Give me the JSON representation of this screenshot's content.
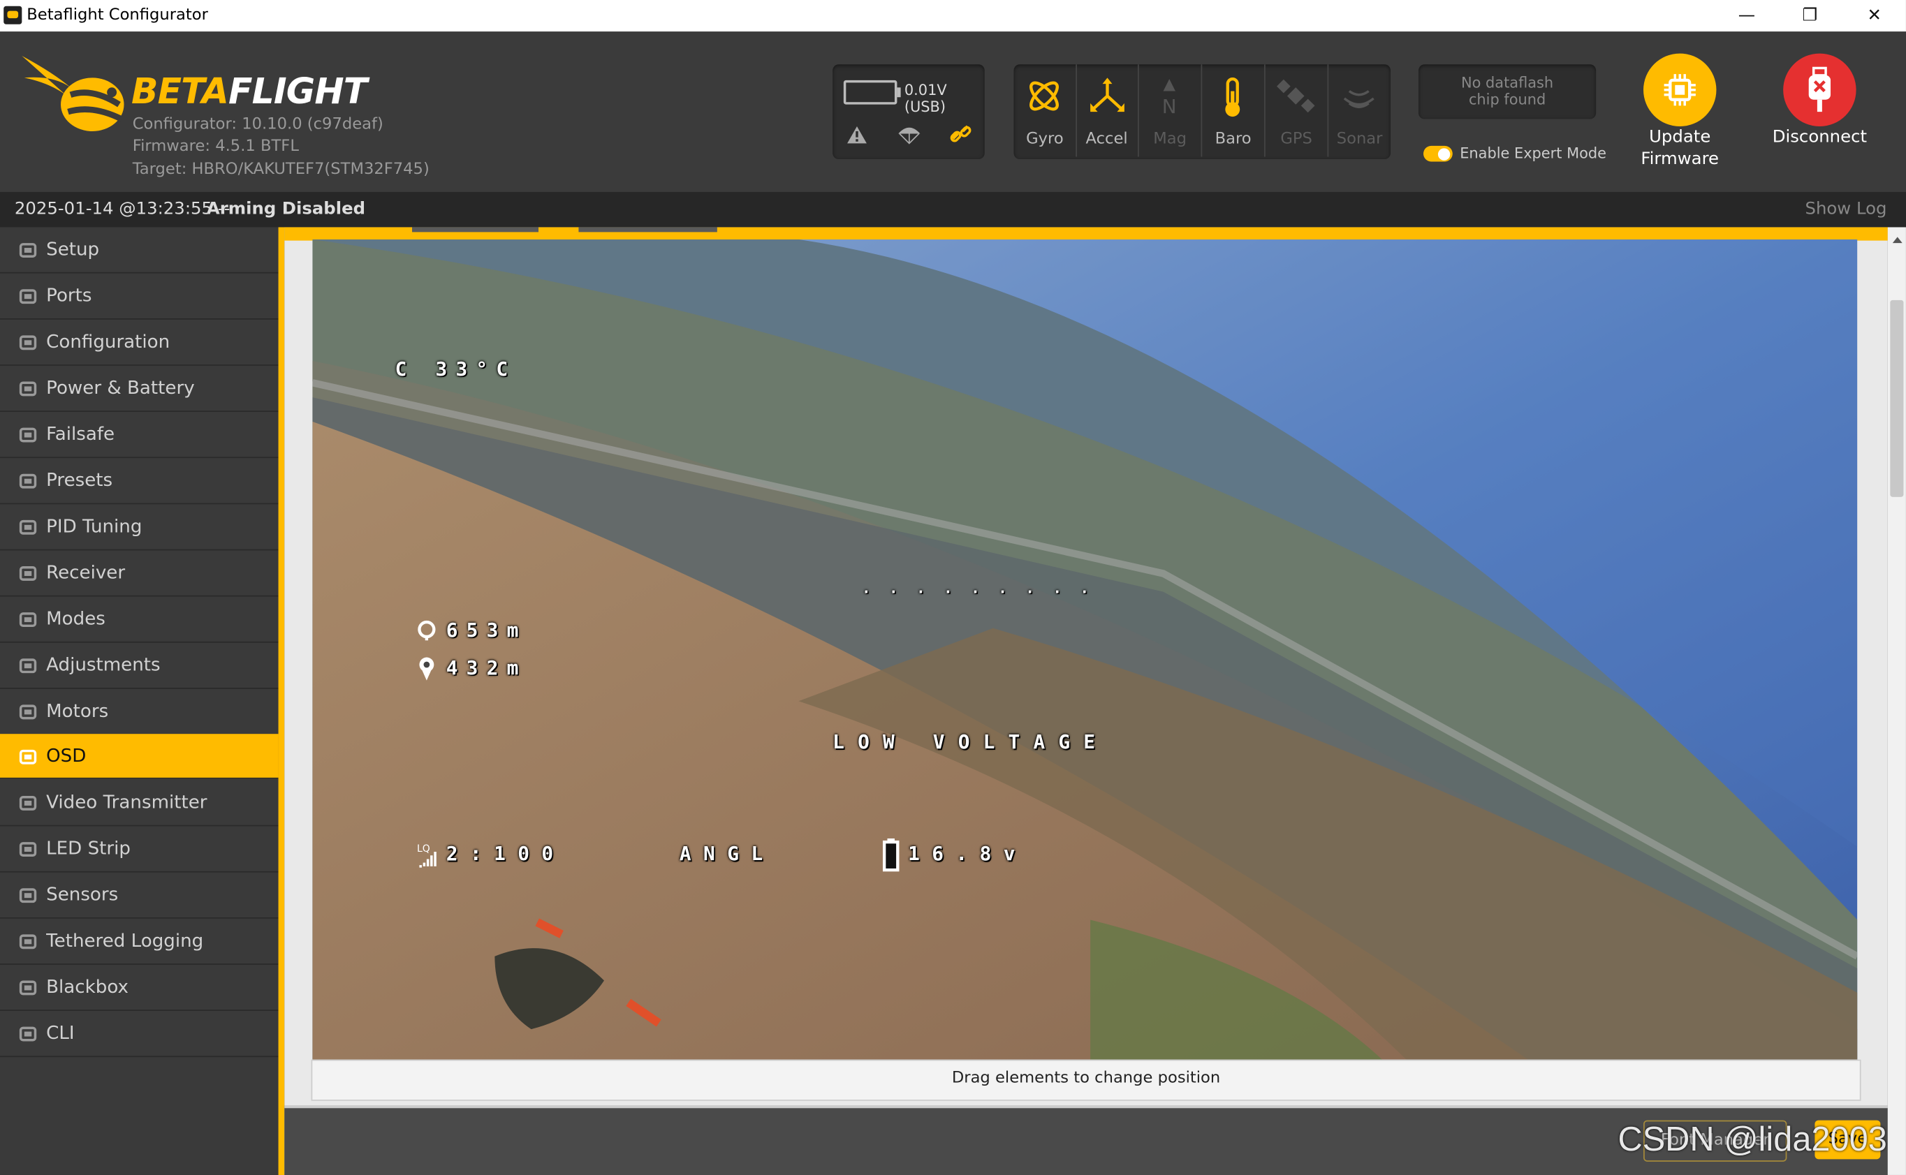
{
  "window": {
    "title": "Betaflight Configurator"
  },
  "header": {
    "brand_left": "BETA",
    "brand_right": "FLIGHT",
    "configurator": "Configurator: 10.10.0 (c97deaf)",
    "firmware": "Firmware: 4.5.1 BTFL",
    "target": "Target: HBRO/KAKUTEF7(STM32F745)",
    "battery_label": "0.01V (USB)",
    "sensors": [
      {
        "label": "Gyro",
        "enabled": true
      },
      {
        "label": "Accel",
        "enabled": true
      },
      {
        "label": "Mag",
        "enabled": false
      },
      {
        "label": "Baro",
        "enabled": true
      },
      {
        "label": "GPS",
        "enabled": false
      },
      {
        "label": "Sonar",
        "enabled": false
      }
    ],
    "dataflash_line1": "No dataflash",
    "dataflash_line2": "chip found",
    "expert_mode_label": "Enable Expert Mode",
    "update_line1": "Update",
    "update_line2": "Firmware",
    "disconnect_label": "Disconnect"
  },
  "status": {
    "timestamp": "2025-01-14 @13:23:55 --",
    "state": "Arming Disabled",
    "show_log": "Show Log"
  },
  "sidebar": {
    "active": "OSD",
    "items": [
      {
        "label": "Setup",
        "icon": "wrench-icon"
      },
      {
        "label": "Ports",
        "icon": "plug-icon"
      },
      {
        "label": "Configuration",
        "icon": "gear-icon"
      },
      {
        "label": "Power & Battery",
        "icon": "battery-icon"
      },
      {
        "label": "Failsafe",
        "icon": "parachute-icon"
      },
      {
        "label": "Presets",
        "icon": "wand-icon"
      },
      {
        "label": "PID Tuning",
        "icon": "pid-icon"
      },
      {
        "label": "Receiver",
        "icon": "receiver-icon"
      },
      {
        "label": "Modes",
        "icon": "toggle-icon"
      },
      {
        "label": "Adjustments",
        "icon": "sliders-icon"
      },
      {
        "label": "Motors",
        "icon": "motor-icon"
      },
      {
        "label": "OSD",
        "icon": "osd-icon"
      },
      {
        "label": "Video Transmitter",
        "icon": "broadcast-icon"
      },
      {
        "label": "LED Strip",
        "icon": "led-icon"
      },
      {
        "label": "Sensors",
        "icon": "pulse-icon"
      },
      {
        "label": "Tethered Logging",
        "icon": "keyboard-icon"
      },
      {
        "label": "Blackbox",
        "icon": "blackbox-icon"
      },
      {
        "label": "CLI",
        "icon": "terminal-icon"
      }
    ]
  },
  "osd": {
    "temperature": "C 33°C",
    "home_distance": "653m",
    "altitude": "432m",
    "warning": "LOW VOLTAGE",
    "link_quality": "2:100",
    "flight_mode": "ANGL",
    "voltage": "16.8v",
    "horizon_dots": ". . . . . . . . ."
  },
  "footer": {
    "hint": "Drag elements to change position",
    "font_manager": "Font Manager",
    "save": "Save"
  },
  "watermark": "CSDN @lida2003",
  "colors": {
    "accent": "#ffbb00",
    "disconnect": "#e53030"
  }
}
